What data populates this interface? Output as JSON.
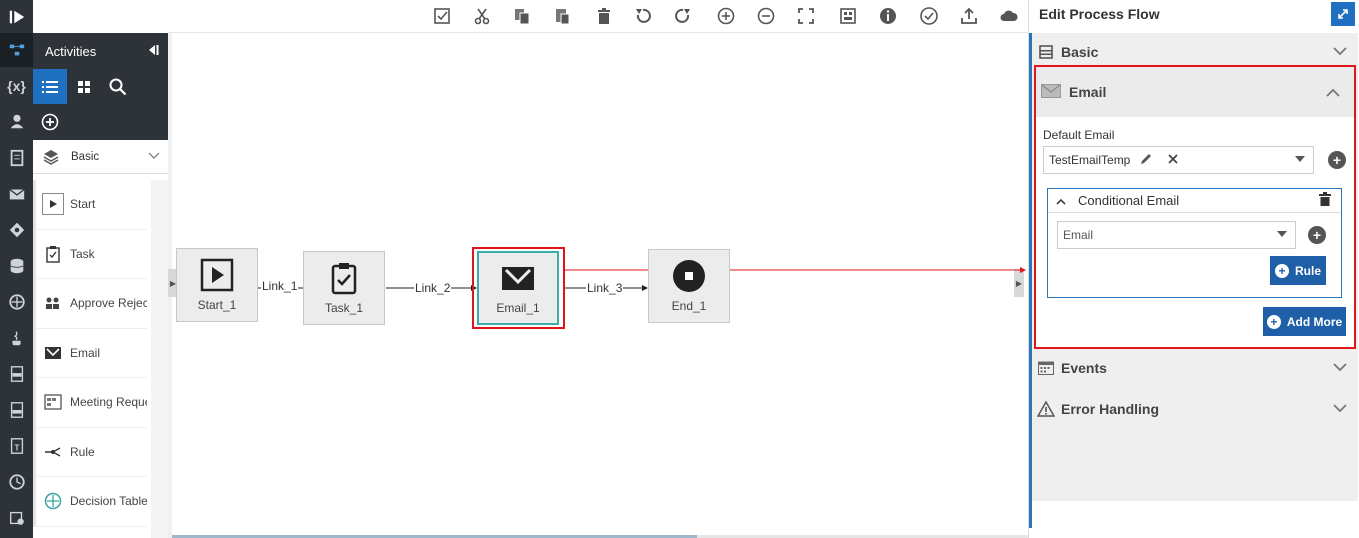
{
  "toolbar": {
    "icons": [
      "validate-icon",
      "cut-icon",
      "copy-icon",
      "paste-icon",
      "delete-icon",
      "undo-icon",
      "redo-icon",
      "zoom-in-icon",
      "zoom-out-icon",
      "fit-screen-icon",
      "grid-icon",
      "info-icon",
      "check-icon",
      "upload-icon",
      "cloud-icon"
    ]
  },
  "rail": {
    "items": [
      "process-flow-icon",
      "variables-icon",
      "users-icon",
      "document-icon",
      "email-icon",
      "decision-icon",
      "database-icon",
      "decision-table-icon",
      "java-icon",
      "html-icon",
      "css-icon",
      "text-icon",
      "clock-icon",
      "settings-icon"
    ],
    "variables_glyph": "{x}"
  },
  "activities": {
    "title": "Activities",
    "group_label": "Basic",
    "items": [
      {
        "label": "Start"
      },
      {
        "label": "Task"
      },
      {
        "label": "Approve Reject"
      },
      {
        "label": "Email"
      },
      {
        "label": "Meeting Request"
      },
      {
        "label": "Rule"
      },
      {
        "label": "Decision Table"
      }
    ]
  },
  "canvas": {
    "nodes": [
      {
        "label": "Start_1"
      },
      {
        "label": "Task_1"
      },
      {
        "label": "Email_1"
      },
      {
        "label": "End_1"
      }
    ],
    "links": [
      "Link_1",
      "Link_2",
      "Link_3"
    ],
    "highlight_color": "#e0161b",
    "selected_color": "#3aafa9"
  },
  "right_panel": {
    "title": "Edit Process Flow",
    "sections": {
      "basic": "Basic",
      "email": "Email",
      "events": "Events",
      "error_handling": "Error Handling"
    },
    "email": {
      "default_label": "Default Email",
      "default_value": "TestEmailTemp",
      "conditional_title": "Conditional Email",
      "conditional_placeholder": "Email",
      "rule_button": "Rule",
      "add_more_button": "Add More"
    },
    "accent": "#1f5fa8"
  }
}
